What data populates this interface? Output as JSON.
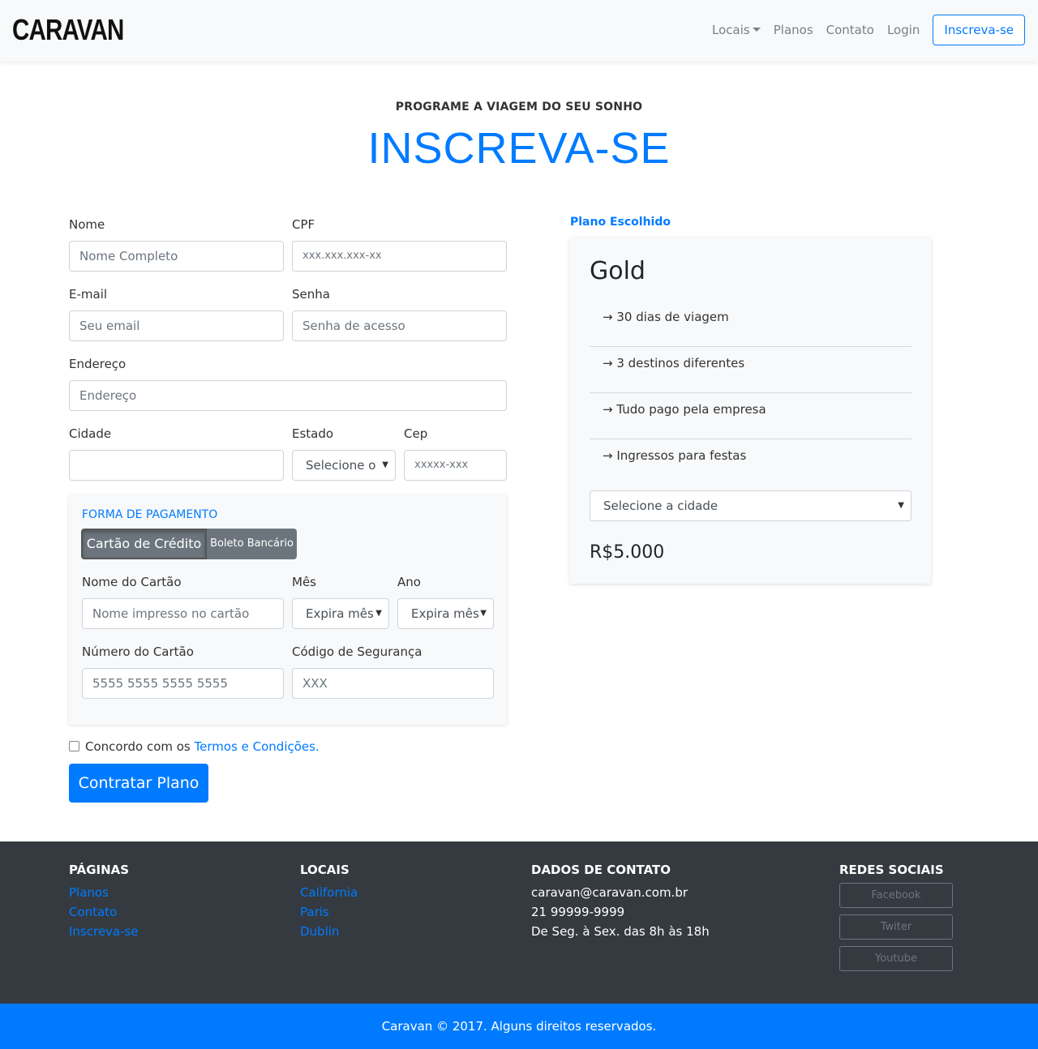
{
  "navbar": {
    "brand": "CARAVAN",
    "links": [
      "Locais",
      "Planos",
      "Contato",
      "Login"
    ],
    "cta": "Inscreva-se"
  },
  "header": {
    "subtitle": "PROGRAME A VIAGEM DO SEU SONHO",
    "title": "INSCREVA-SE"
  },
  "form": {
    "nome": {
      "label": "Nome",
      "placeholder": "Nome Completo"
    },
    "cpf": {
      "label": "CPF",
      "placeholder": "xxx.xxx.xxx-xx"
    },
    "email": {
      "label": "E-mail",
      "placeholder": "Seu email"
    },
    "senha": {
      "label": "Senha",
      "placeholder": "Senha de acesso"
    },
    "endereco": {
      "label": "Endereço",
      "placeholder": "Endereço"
    },
    "cidade": {
      "label": "Cidade",
      "value": ""
    },
    "estado": {
      "label": "Estado",
      "selected": "Selecione o"
    },
    "cep": {
      "label": "Cep",
      "placeholder": "xxxxx-xxx"
    }
  },
  "payment": {
    "title": "FORMA DE PAGAMENTO",
    "tabs": [
      "Cartão de Crédito",
      "Boleto Bancário"
    ],
    "active_tab": "Cartão de Crédito",
    "nome_cartao": {
      "label": "Nome do Cartão",
      "placeholder": "Nome impresso no cartão"
    },
    "mes": {
      "label": "Mês",
      "selected": "Expira mês"
    },
    "ano": {
      "label": "Ano",
      "selected": "Expira mês"
    },
    "numero": {
      "label": "Número do Cartão",
      "placeholder": "5555 5555 5555 5555"
    },
    "codigo": {
      "label": "Código de Segurança",
      "placeholder": "XXX"
    }
  },
  "terms": {
    "text": "Concordo com os",
    "link": "Termos e Condições.",
    "checked": false
  },
  "submit_label": "Contratar Plano",
  "plan": {
    "heading": "Plano Escolhido",
    "name": "Gold",
    "features": [
      "→ 30 dias de viagem",
      "→ 3 destinos diferentes",
      "→ Tudo pago pela empresa",
      "→ Ingressos para festas"
    ],
    "city_select": "Selecione a cidade",
    "price": "R$5.000"
  },
  "footer": {
    "paginas": {
      "title": "PÁGINAS",
      "links": [
        "Planos",
        "Contato",
        "Inscreva-se"
      ]
    },
    "locais": {
      "title": "LOCAIS",
      "links": [
        "California",
        "Paris",
        "Dublin"
      ]
    },
    "contato": {
      "title": "DADOS DE CONTATO",
      "lines": [
        "caravan@caravan.com.br",
        "21 99999-9999",
        "De Seg. à Sex. das 8h às 18h"
      ]
    },
    "redes": {
      "title": "REDES SOCIAIS",
      "buttons": [
        "Facebook",
        "Twiter",
        "Youtube"
      ]
    },
    "copyright": "Caravan © 2017. Alguns direitos reservados."
  },
  "colors": {
    "primary": "#007bff",
    "dark": "#343a40",
    "light": "#f8f9fa",
    "secondary": "#6c757d"
  }
}
